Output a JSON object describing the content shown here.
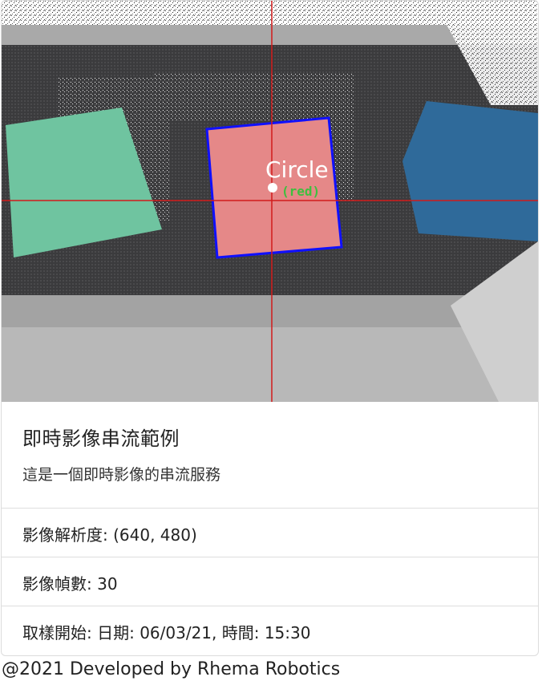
{
  "stream": {
    "overlay_label": "Circle",
    "overlay_sublabel": "(red)",
    "colors": {
      "crosshair": "#d21a1a",
      "bounding_box": "#1010ff",
      "sublabel": "#3fbf3f",
      "green_cube": "#6fc4a0",
      "red_cube": "#e58888",
      "blue_cube": "#2f6a9a"
    }
  },
  "card": {
    "title": "即時影像串流範例",
    "text": "這是一個即時影像的串流服務"
  },
  "info": [
    {
      "text": "影像解析度: (640, 480)"
    },
    {
      "text": "影像幀數: 30"
    },
    {
      "text": "取樣開始: 日期: 06/03/21, 時間: 15:30"
    }
  ],
  "footer": {
    "text": "@2021 Developed by Rhema Robotics"
  }
}
